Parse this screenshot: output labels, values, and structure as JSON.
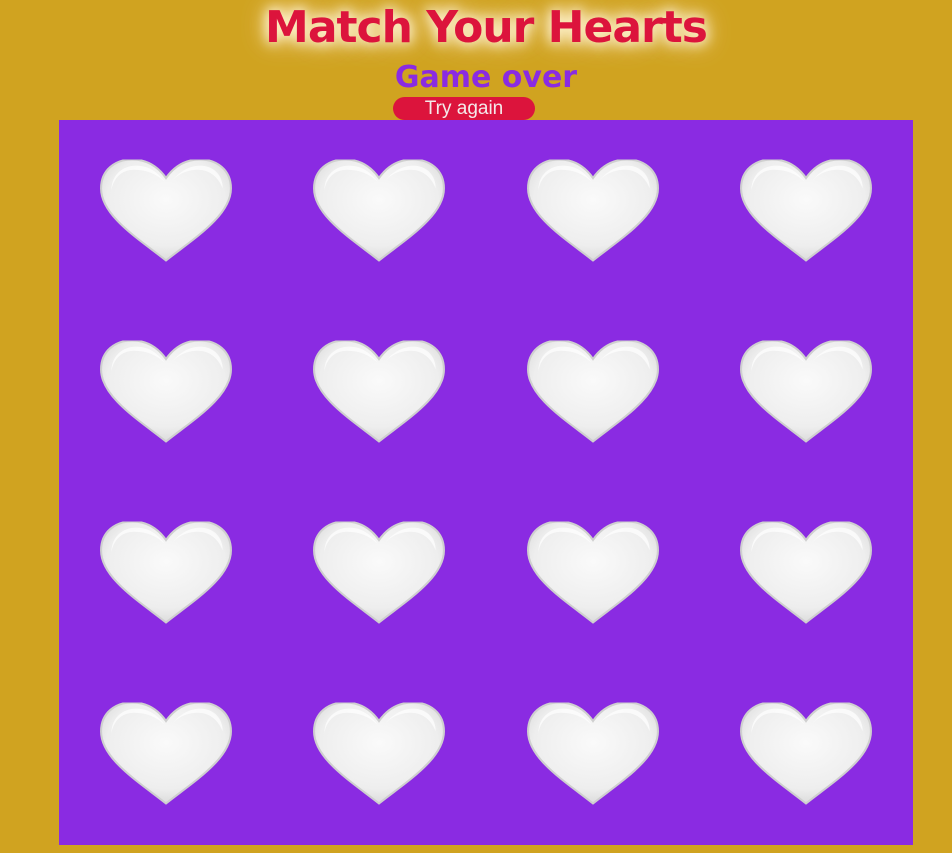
{
  "header": {
    "title": "Match Your Hearts",
    "status": "Game over",
    "try_again_label": "Try again"
  },
  "board": {
    "rows": 4,
    "columns": 4,
    "card_icon": "white-heart-icon",
    "cards_face_down": 16
  },
  "colors": {
    "page_background": "#d0a320",
    "board_background": "#8a2be2",
    "title": "#dc143c",
    "status": "#8a2be2",
    "button": "#dc143c",
    "heart": "#ededed"
  }
}
